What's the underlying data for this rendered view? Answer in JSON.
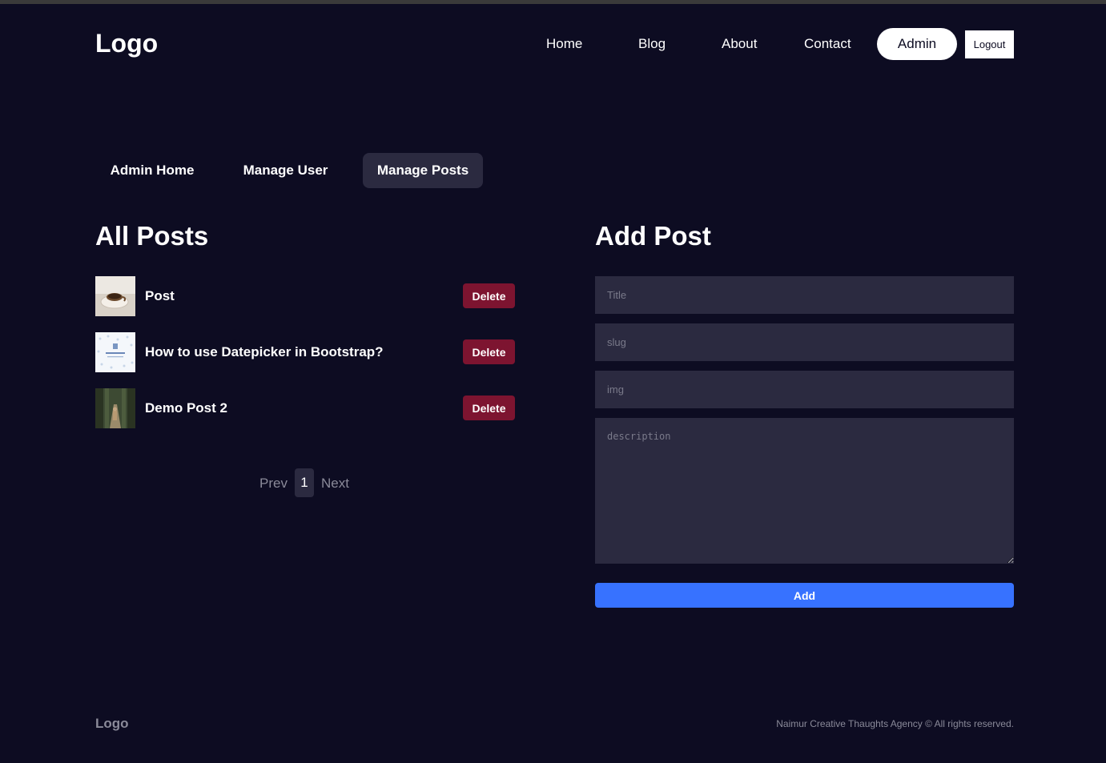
{
  "header": {
    "logo": "Logo",
    "nav": {
      "home": "Home",
      "blog": "Blog",
      "about": "About",
      "contact": "Contact",
      "admin": "Admin",
      "logout": "Logout"
    }
  },
  "admin_tabs": {
    "home": "Admin Home",
    "users": "Manage User",
    "posts": "Manage Posts",
    "active": "Manage Posts"
  },
  "posts_section": {
    "heading": "All Posts",
    "delete_label": "Delete",
    "items": [
      {
        "title": "Post",
        "thumb": "coffee-cup-image"
      },
      {
        "title": "How to use Datepicker in Bootstrap?",
        "thumb": "datepicker-article-image"
      },
      {
        "title": "Demo Post 2",
        "thumb": "forest-path-image"
      }
    ]
  },
  "pagination": {
    "prev": "Prev",
    "current": "1",
    "next": "Next"
  },
  "add_post": {
    "heading": "Add Post",
    "title_placeholder": "Title",
    "slug_placeholder": "slug",
    "img_placeholder": "img",
    "description_placeholder": "description",
    "submit": "Add"
  },
  "footer": {
    "logo": "Logo",
    "copyright": "Naimur Creative Thaughts Agency © All rights reserved."
  },
  "colors": {
    "background": "#0d0c22",
    "panel": "#2b2a40",
    "delete": "#7d1430",
    "primary": "#3772ff"
  }
}
